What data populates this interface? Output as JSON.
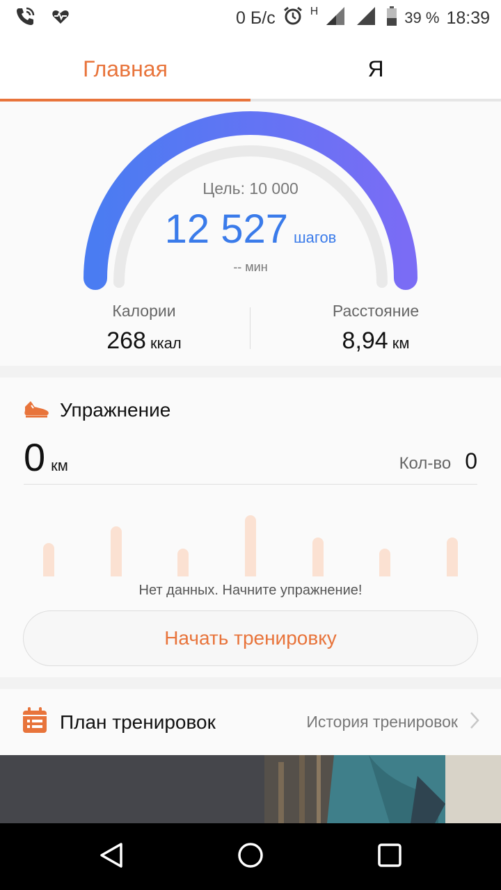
{
  "status_bar": {
    "net_speed": "0 Б/с",
    "network_letter": "H",
    "battery": "39 %",
    "time": "18:39"
  },
  "tabs": [
    {
      "label": "Главная",
      "active": true
    },
    {
      "label": "Я",
      "active": false
    }
  ],
  "steps": {
    "goal_label": "Цель: 10 000",
    "value": "12 527",
    "unit": "шагов",
    "minutes": "-- мин"
  },
  "metrics": {
    "calories": {
      "label": "Калории",
      "value": "268",
      "unit": "ккал"
    },
    "distance": {
      "label": "Расстояние",
      "value": "8,94",
      "unit": "км"
    }
  },
  "exercise": {
    "title": "Упражнение",
    "distance_value": "0",
    "distance_unit": "км",
    "count_label": "Кол-во",
    "count_value": "0",
    "no_data": "Нет данных. Начните упражнение!",
    "start_button": "Начать тренировку"
  },
  "plan": {
    "title": "План тренировок",
    "history": "История тренировок"
  },
  "colors": {
    "accent": "#e8743b",
    "steps_blue": "#3a7bea",
    "gauge_start": "#4a7cf2",
    "gauge_end": "#7a6cf5"
  },
  "icons": {
    "status_left": [
      "phone-wifi-call-icon",
      "heart-rate-icon"
    ],
    "status_right": [
      "alarm-icon",
      "signal-icon",
      "battery-icon"
    ],
    "exercise": "running-shoe-icon",
    "plan": "calendar-icon",
    "plan_chevron": "chevron-right-icon",
    "nav": [
      "back-icon",
      "home-icon",
      "recents-icon"
    ]
  }
}
